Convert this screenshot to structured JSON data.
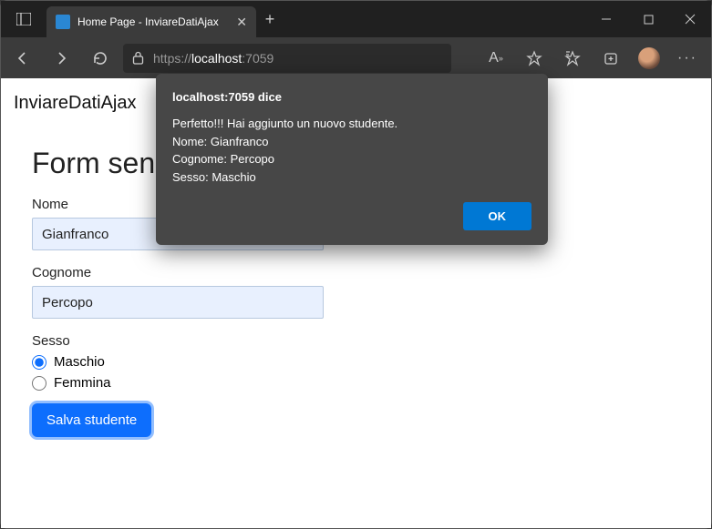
{
  "browser": {
    "tab_title": "Home Page - InviareDatiAjax",
    "url_prefix": "https://",
    "url_host": "localhost",
    "url_port": ":7059"
  },
  "page": {
    "brand": "InviareDatiAjax",
    "form_title": "Form senza convalida dei dati",
    "labels": {
      "nome": "Nome",
      "cognome": "Cognome",
      "sesso": "Sesso",
      "maschio": "Maschio",
      "femmina": "Femmina"
    },
    "values": {
      "nome": "Gianfranco",
      "cognome": "Percopo"
    },
    "submit_label": "Salva studente"
  },
  "alert": {
    "title": "localhost:7059 dice",
    "line1": "Perfetto!!! Hai aggiunto un nuovo studente.",
    "line2": "Nome: Gianfranco",
    "line3": "Cognome: Percopo",
    "line4": "Sesso: Maschio",
    "ok_label": "OK"
  }
}
